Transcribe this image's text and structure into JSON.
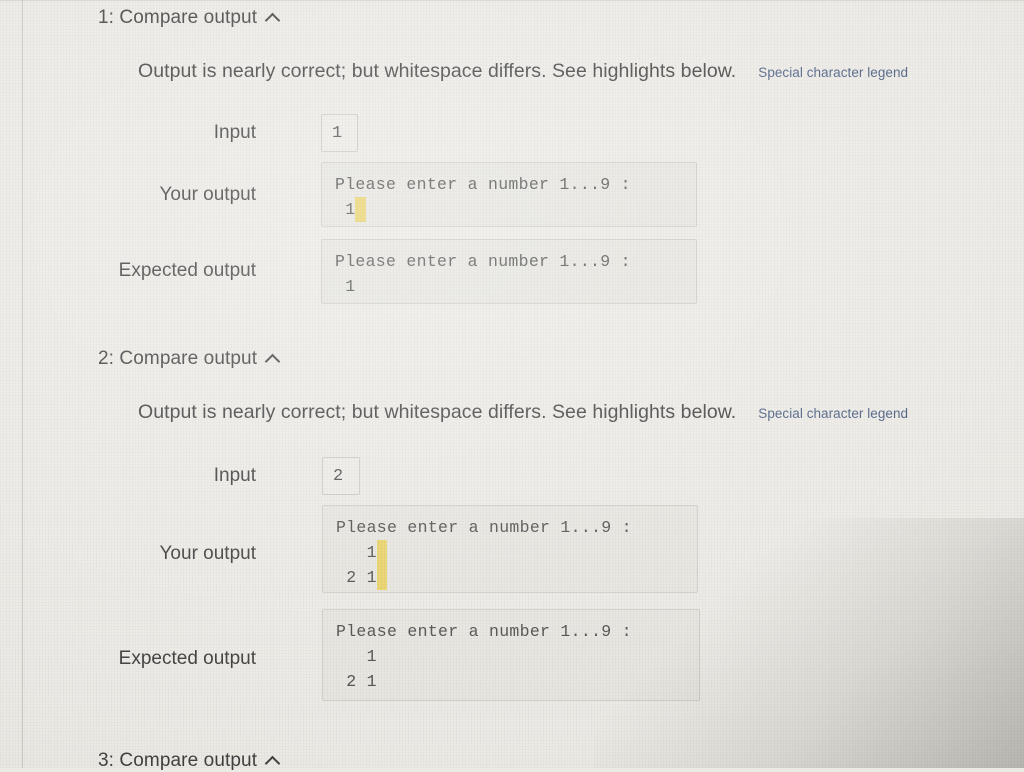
{
  "page": {
    "background_color": "#eceae4",
    "highlight_color": "#e9d164",
    "link_color": "#44587f",
    "text_color": "#3a3a3a"
  },
  "labels": {
    "input": "Input",
    "your_output": "Your output",
    "expected_output": "Expected output"
  },
  "sections": [
    {
      "title": "1: Compare output",
      "collapse_icon": "chevron-up-icon",
      "status": "Output is nearly correct; but whitespace differs. See highlights below.",
      "legend_link": "Special character legend",
      "input_value": "1",
      "your_output": {
        "line1": "Please enter a number 1...9 :",
        "line2_prefix": " 1",
        "line2_highlight": " "
      },
      "expected_output": {
        "line1": "Please enter a number 1...9 :",
        "line2": " 1"
      }
    },
    {
      "title": "2: Compare output",
      "collapse_icon": "chevron-up-icon",
      "status": "Output is nearly correct; but whitespace differs. See highlights below.",
      "legend_link": "Special character legend",
      "input_value": "2",
      "your_output": {
        "line1": "Please enter a number 1...9 :",
        "line2_prefix": "   1",
        "line2_highlight": " ",
        "line3_prefix": " 2 1",
        "line3_highlight": " "
      },
      "expected_output": {
        "line1": "Please enter a number 1...9 :",
        "line2": "   1",
        "line3": " 2 1"
      }
    },
    {
      "title": "3: Compare output",
      "collapse_icon": "chevron-up-icon"
    }
  ]
}
